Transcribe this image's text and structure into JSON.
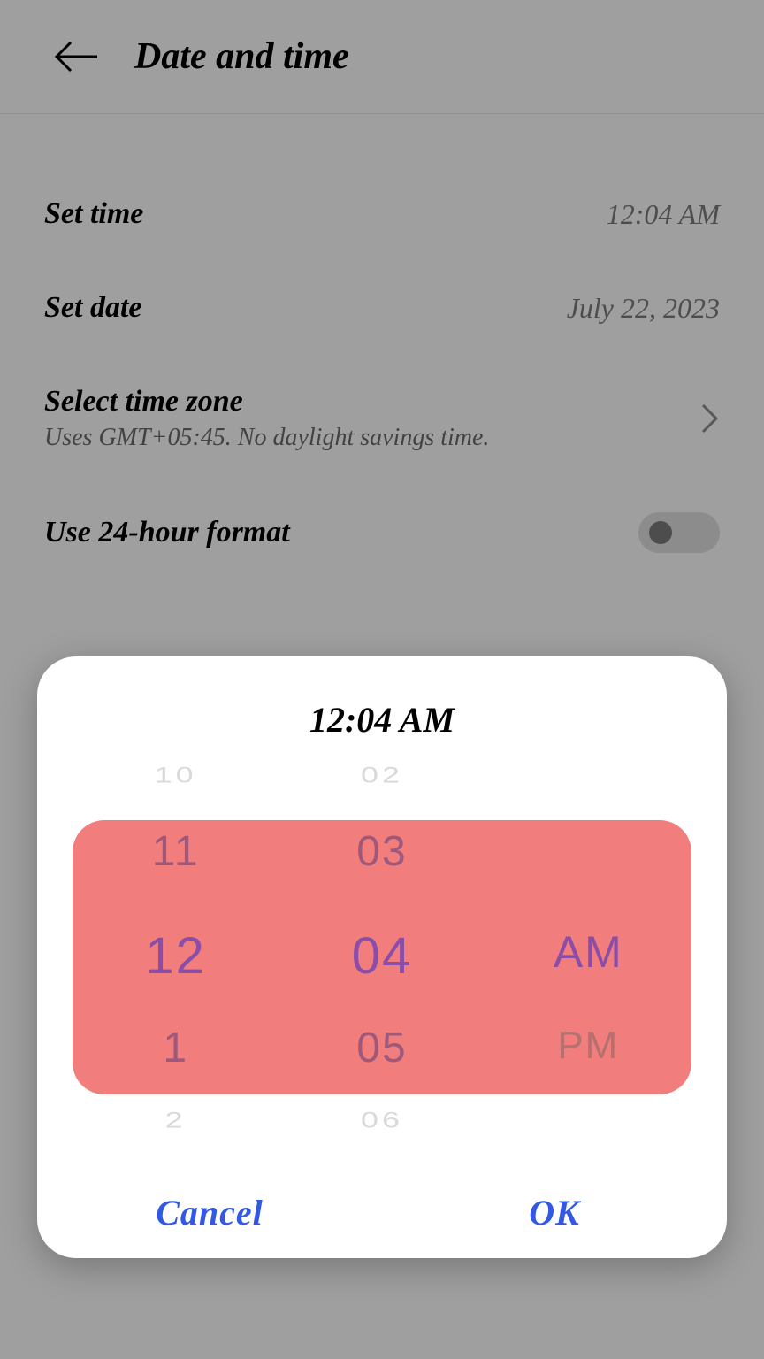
{
  "header": {
    "title": "Date and time"
  },
  "settings": {
    "set_time": {
      "label": "Set time",
      "value": "12:04 AM"
    },
    "set_date": {
      "label": "Set date",
      "value": "July 22, 2023"
    },
    "timezone": {
      "label": "Select time zone",
      "sub": "Uses GMT+05:45. No daylight savings time."
    },
    "use_24h": {
      "label": "Use 24-hour format"
    }
  },
  "dialog": {
    "title": "12:04 AM",
    "hours": {
      "p_minus2": "10",
      "p_minus1": "11",
      "center": "12",
      "p_plus1": "1",
      "p_plus2": "2"
    },
    "minutes": {
      "p_minus2": "02",
      "p_minus1": "03",
      "center": "04",
      "p_plus1": "05",
      "p_plus2": "06"
    },
    "ampm": {
      "center": "AM",
      "p_plus1": "PM"
    },
    "cancel": "Cancel",
    "ok": "OK"
  }
}
